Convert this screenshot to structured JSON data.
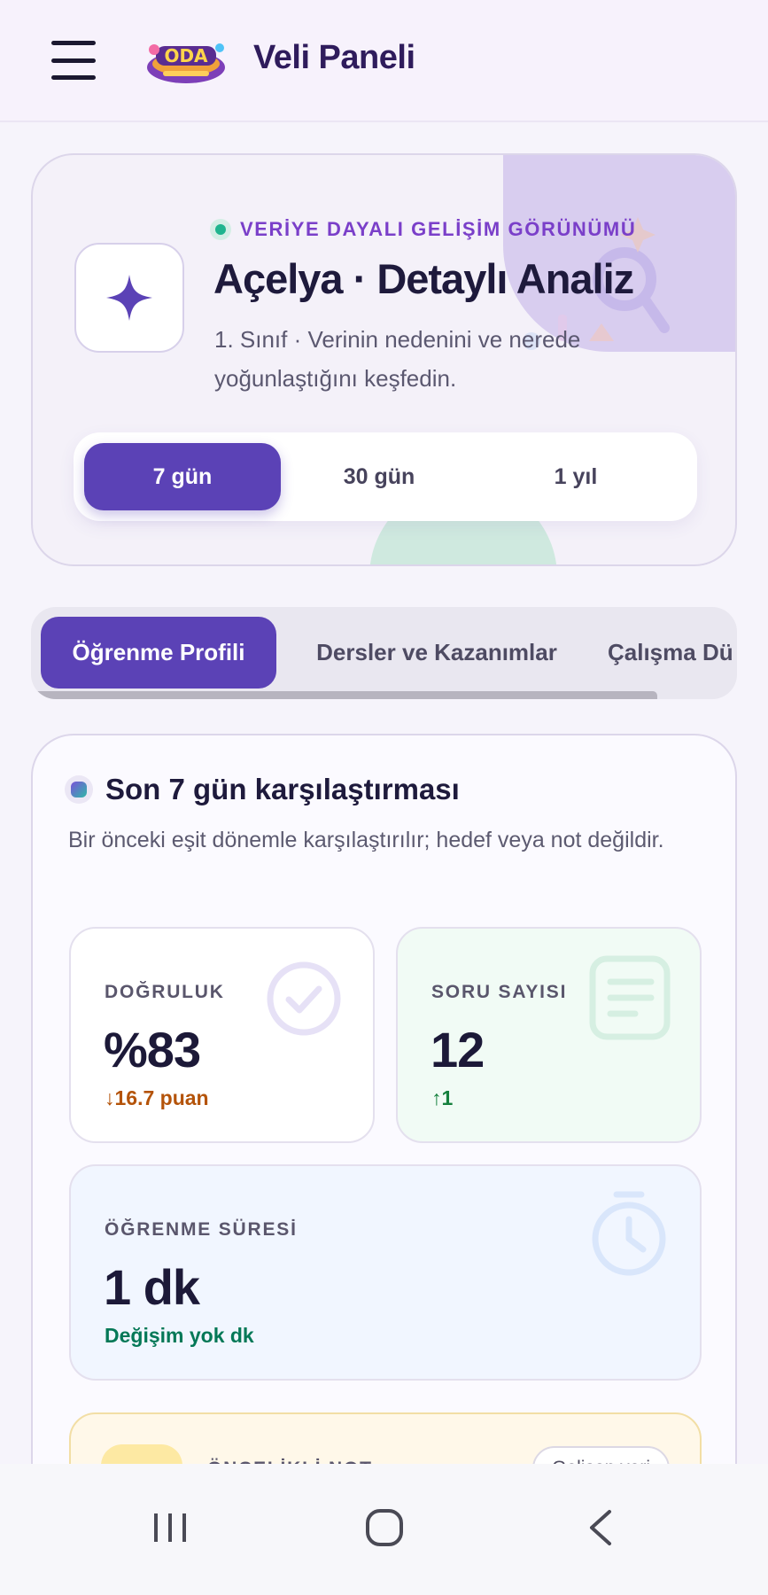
{
  "appbar": {
    "title": "Veli Paneli",
    "logo_text": "ODA"
  },
  "hero": {
    "kicker": "VERİYE DAYALI GELİŞİM GÖRÜNÜMÜ",
    "title": "Açelya · Detaylı Analiz",
    "subtitle": "1. Sınıf · Verinin nedenini ve nerede yoğunlaştığını keşfedin.",
    "ranges": [
      {
        "label": "7 gün",
        "active": true
      },
      {
        "label": "30 gün",
        "active": false
      },
      {
        "label": "1 yıl",
        "active": false
      }
    ]
  },
  "tabs": [
    {
      "label": "Öğrenme Profili",
      "active": true
    },
    {
      "label": "Dersler ve Kazanımlar",
      "active": false
    },
    {
      "label": "Çalışma Dü",
      "active": false
    }
  ],
  "comparison": {
    "title": "Son 7 gün karşılaştırması",
    "subtitle": "Bir önceki eşit dönemle karşılaştırılır; hedef veya not değildir.",
    "stats": {
      "accuracy": {
        "label": "DOĞRULUK",
        "value": "%83",
        "delta": "16.7 puan",
        "delta_color": "#b45309",
        "icon": "check-circle-icon"
      },
      "questions": {
        "label": "SORU SAYISI",
        "value": "12",
        "delta": "1",
        "delta_color": "#15803d",
        "icon": "document-icon"
      },
      "time": {
        "label": "ÖĞRENME SÜRESİ",
        "value": "1 dk",
        "delta": "Değişim yok dk",
        "delta_color": "#047857",
        "icon": "stopwatch-icon"
      }
    },
    "priority": {
      "label": "ÖNCELİKLİ NOT",
      "badge": "Gelişen veri",
      "icon": "trend-arrow-icon"
    }
  },
  "colors": {
    "accent": "#5b42b6",
    "kicker": "#7a3fc9",
    "success": "#1fb48e"
  }
}
